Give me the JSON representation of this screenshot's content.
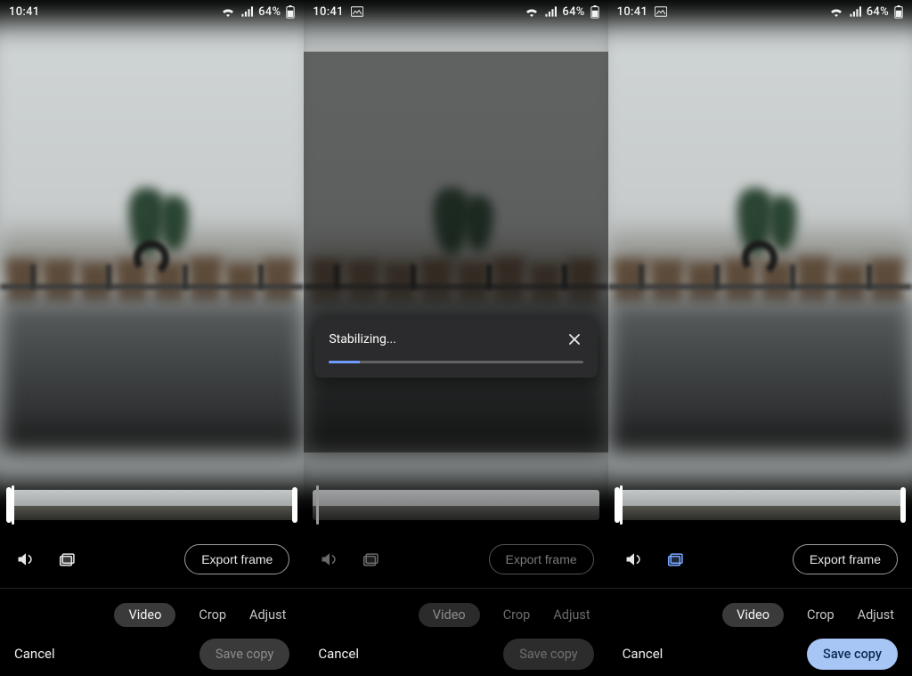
{
  "status": {
    "time": "10:41",
    "battery": "64%"
  },
  "toolbar": {
    "export_frame": "Export frame"
  },
  "tabs": {
    "video": "Video",
    "crop": "Crop",
    "adjust": "Adjust"
  },
  "footer": {
    "cancel": "Cancel",
    "save_copy": "Save copy"
  },
  "modal": {
    "label": "Stabilizing...",
    "progress_pct": 12
  },
  "panes": [
    {
      "has_gallery_icon": false,
      "dimmed": false,
      "stabilize_active": false,
      "export_style": "normal",
      "tabs_dimmed": false,
      "save_enabled": false,
      "show_modal": false,
      "scrub_pos_pct": 1,
      "show_handles": true
    },
    {
      "has_gallery_icon": true,
      "dimmed": true,
      "stabilize_active": false,
      "export_style": "dim",
      "tabs_dimmed": true,
      "save_enabled": false,
      "show_modal": true,
      "scrub_pos_pct": 1,
      "show_handles": false,
      "cancel_dimmed": false
    },
    {
      "has_gallery_icon": true,
      "dimmed": false,
      "stabilize_active": true,
      "export_style": "normal",
      "tabs_dimmed": false,
      "save_enabled": true,
      "show_modal": false,
      "scrub_pos_pct": 1,
      "show_handles": true
    }
  ]
}
